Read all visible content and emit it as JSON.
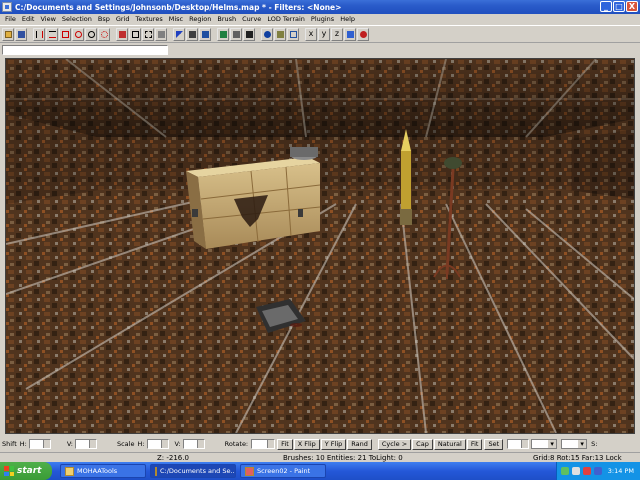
{
  "window": {
    "title": "C:/Documents and Settings/Johnsonb/Desktop/Helms.map * - Filters: <None>",
    "buttons": [
      "_",
      "□",
      "X"
    ]
  },
  "menu": [
    "File",
    "Edit",
    "View",
    "Selection",
    "Bsp",
    "Grid",
    "Textures",
    "Misc",
    "Region",
    "Brush",
    "Curve",
    "LOD Terrain",
    "Plugins",
    "Help"
  ],
  "toolbar": {
    "icons": [
      "open-icon",
      "save-icon",
      "flip-x-icon",
      "flip-y-icon",
      "flip-z-icon",
      "rotate-x-icon",
      "rotate-y-icon",
      "rotate-z-icon",
      "csg-subtract-icon",
      "select-complete-icon",
      "select-touching-icon",
      "select-inside-icon",
      "clipper-icon",
      "texture-lock-icon",
      "camera-icon",
      "entity-icon",
      "patch-icon",
      "vertex-edit-icon",
      "face-edit-icon",
      "drag-icon",
      "scale-icon",
      "x-axis-icon",
      "y-axis-icon",
      "z-axis-icon",
      "grow-icon",
      "eye-icon"
    ]
  },
  "surface": {
    "shift_label": "Shift",
    "h_label": "H:",
    "v_label": "V:",
    "scale_label": "Scale",
    "rotate_label": "Rotate:",
    "buttons": [
      "Fit",
      "X Flip",
      "Y Flip",
      "Rand",
      "Cycle >",
      "Cap",
      "Natural",
      "Fit",
      "Set"
    ],
    "s_label": "S:"
  },
  "status": {
    "z": "Z: -216.0",
    "counts": "Brushes: 10 Entities: 21 ToLight: 0",
    "grid": "Grid:8 Rot:15 Far:13 Lock"
  },
  "taskbar": {
    "start": "start",
    "tasks": [
      "MOHAATools",
      "C:/Documents and Se...",
      "Screen02 - Paint"
    ],
    "clock": "3:14 PM"
  },
  "colors": {
    "titlebar": "#2a5bc9",
    "taskbar": "#2458d8",
    "start": "#3a9b36",
    "rust": "#7a4a2a"
  }
}
